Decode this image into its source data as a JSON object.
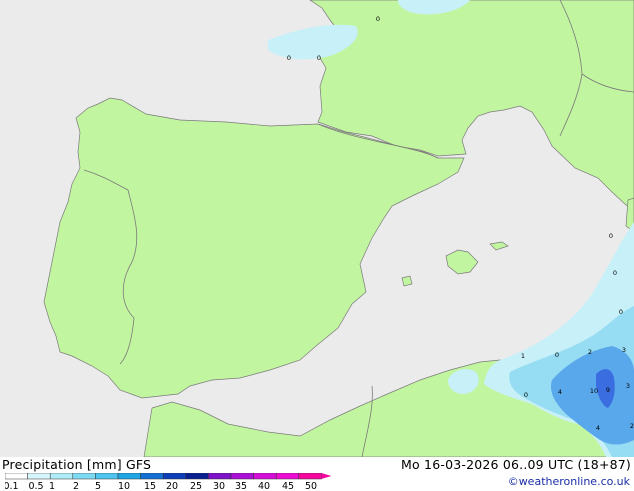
{
  "footer": {
    "title": "Precipitation [mm]  GFS",
    "datetime": "Mo 16-03-2026 06..09 UTC (18+87)",
    "credit": "©weatheronline.co.uk"
  },
  "colors": {
    "sea": "#ebebeb",
    "land": "#c2f5a0",
    "border": "#7a7a7a",
    "precip_light": "#c8f0f8",
    "precip_mid": "#96dcf2",
    "precip_heavy": "#5aa8ec",
    "precip_core": "#3a6ee0"
  },
  "legend": {
    "labels": [
      "0.1",
      "0.5",
      "1",
      "2",
      "5",
      "10",
      "15",
      "20",
      "25",
      "30",
      "35",
      "40",
      "45",
      "50"
    ],
    "colors": [
      "#ffffff",
      "#d6f6fb",
      "#b0ecf7",
      "#7edaf3",
      "#4ec4ee",
      "#1fa5e4",
      "#1470d4",
      "#0e3fb8",
      "#0a2090",
      "#7d12c8",
      "#aa10d6",
      "#d40ed8",
      "#ec0cd2",
      "#f6089e"
    ]
  },
  "map_values": [
    "0",
    "0",
    "0",
    "0",
    "0",
    "0",
    "1",
    "0",
    "0",
    "2",
    "3",
    "9",
    "4",
    "10",
    "3",
    "4",
    "2"
  ]
}
